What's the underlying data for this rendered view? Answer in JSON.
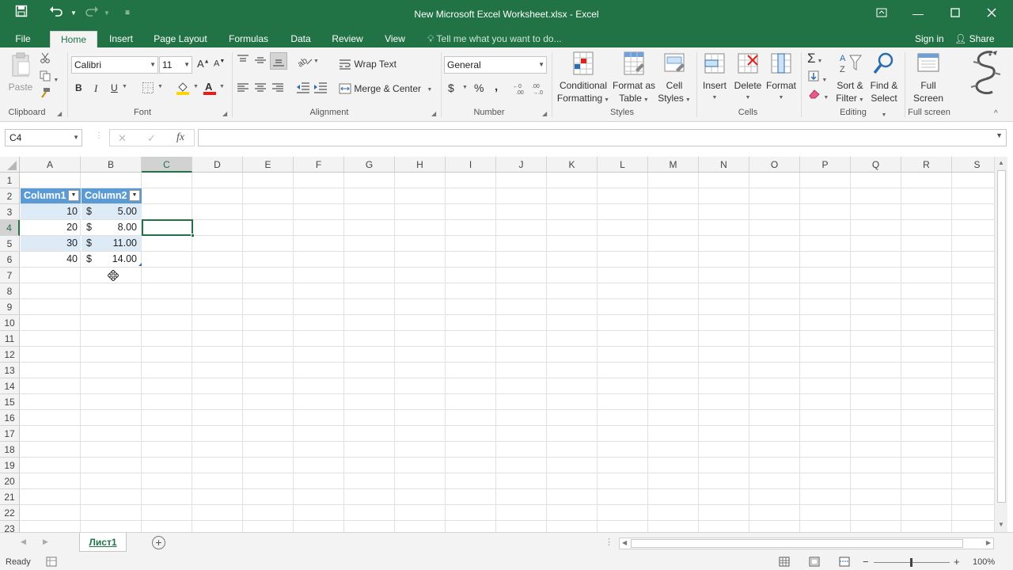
{
  "titlebar": {
    "title": "New Microsoft Excel Worksheet.xlsx - Excel",
    "qat_icons": [
      "save-icon",
      "undo-icon",
      "redo-icon",
      "customize-qat-icon"
    ],
    "window_buttons": [
      "ribbon-display-icon",
      "minimize-icon",
      "maximize-icon",
      "close-icon"
    ]
  },
  "tabs": [
    "File",
    "Home",
    "Insert",
    "Page Layout",
    "Formulas",
    "Data",
    "Review",
    "View"
  ],
  "active_tab": "Home",
  "tell_me": "Tell me what you want to do...",
  "account": {
    "sign_in": "Sign in",
    "share": "Share"
  },
  "ribbon": {
    "clipboard": {
      "label": "Clipboard",
      "paste": "Paste"
    },
    "font": {
      "label": "Font",
      "name": "Calibri",
      "size": "11",
      "bold": "B",
      "italic": "I",
      "underline": "U"
    },
    "alignment": {
      "label": "Alignment",
      "wrap_text": "Wrap Text",
      "merge_center": "Merge & Center"
    },
    "number": {
      "label": "Number",
      "format": "General",
      "currency": "$",
      "percent": "%",
      "comma": ","
    },
    "styles": {
      "label": "Styles",
      "conditional_1": "Conditional",
      "conditional_2": "Formatting",
      "format_table_1": "Format as",
      "format_table_2": "Table",
      "cell_styles_1": "Cell",
      "cell_styles_2": "Styles"
    },
    "cells": {
      "label": "Cells",
      "insert": "Insert",
      "delete": "Delete",
      "format": "Format"
    },
    "editing": {
      "label": "Editing",
      "sort_1": "Sort &",
      "sort_2": "Filter",
      "find_1": "Find &",
      "find_2": "Select"
    },
    "fullscreen": {
      "label": "Full screen",
      "btn_1": "Full",
      "btn_2": "Screen"
    }
  },
  "formula_bar": {
    "name_box": "C4",
    "fx": "fx",
    "content": ""
  },
  "columns": [
    "A",
    "B",
    "C",
    "D",
    "E",
    "F",
    "G",
    "H",
    "I",
    "J",
    "K",
    "L",
    "M",
    "N",
    "O",
    "P",
    "Q",
    "R",
    "S"
  ],
  "rows": [
    "1",
    "2",
    "3",
    "4",
    "5",
    "6",
    "7",
    "8",
    "9",
    "10",
    "11",
    "12",
    "13",
    "14",
    "15",
    "16",
    "17",
    "18",
    "19",
    "20",
    "21",
    "22",
    "23"
  ],
  "selected_cell": "C4",
  "table": {
    "headers": [
      "Column1",
      "Column2"
    ],
    "rows": [
      {
        "a": "10",
        "currency": "$",
        "b": "5.00"
      },
      {
        "a": "20",
        "currency": "$",
        "b": "8.00"
      },
      {
        "a": "30",
        "currency": "$",
        "b": "11.00"
      },
      {
        "a": "40",
        "currency": "$",
        "b": "14.00"
      }
    ]
  },
  "sheet": {
    "name": "Лист1"
  },
  "status": {
    "ready": "Ready",
    "zoom": "100%"
  },
  "colors": {
    "accent": "#217346",
    "table_header": "#5b9bd5",
    "table_band": "#ddebf7"
  }
}
